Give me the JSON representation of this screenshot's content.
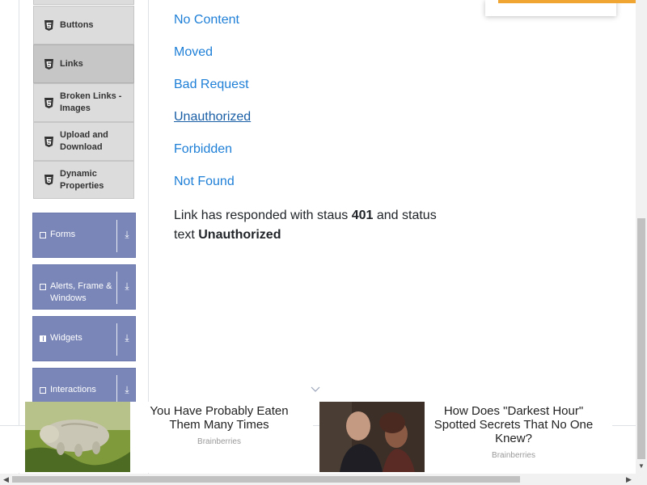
{
  "sidebar": {
    "sub_items": [
      {
        "label": "Buttons",
        "icon": "html5-icon"
      },
      {
        "label": "Links",
        "icon": "html5-icon",
        "active": true
      },
      {
        "label": "Broken Links - Images",
        "icon": "html5-icon"
      },
      {
        "label": "Upload and Download",
        "icon": "html5-icon"
      },
      {
        "label": "Dynamic Properties",
        "icon": "html5-icon"
      }
    ],
    "groups": [
      {
        "label": "Forms",
        "icon": "form-icon"
      },
      {
        "label": "Alerts, Frame & Windows",
        "icon": "window-icon"
      },
      {
        "label": "Widgets",
        "icon": "widgets-icon"
      },
      {
        "label": "Interactions",
        "icon": "interactions-icon"
      }
    ]
  },
  "links": [
    "No Content",
    "Moved",
    "Bad Request",
    "Unauthorized",
    "Forbidden",
    "Not Found"
  ],
  "response": {
    "prefix": "Link has responded with staus",
    "code": "401",
    "middle": "and status text",
    "status_text": "Unauthorized"
  },
  "ads": [
    {
      "title": "You Have Probably Eaten Them Many Times",
      "source": "Brainberries"
    },
    {
      "title": "How Does \"Darkest Hour\" Spotted Secrets That No One Knew?",
      "source": "Brainberries"
    }
  ],
  "colors": {
    "link": "#1e7fd7",
    "group_bg": "#7986b7",
    "accent_bar": "#f0a431",
    "sub_item_bg": "#dcdcdc"
  }
}
